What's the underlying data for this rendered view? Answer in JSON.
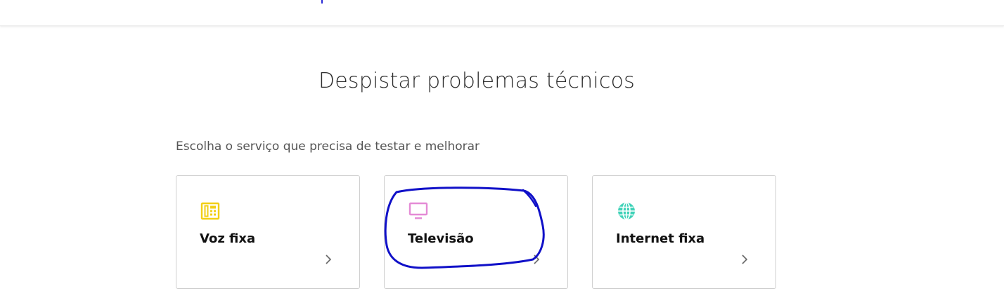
{
  "header": {
    "accent_color": "#2a2ad6"
  },
  "page": {
    "title": "Despistar problemas técnicos",
    "subtitle": "Escolha o serviço que precisa de testar e melhorar"
  },
  "services": [
    {
      "label": "Voz fixa",
      "icon": "phone-icon",
      "icon_color": "#f2cf16"
    },
    {
      "label": "Televisão",
      "icon": "tv-icon",
      "icon_color": "#e48bd6"
    },
    {
      "label": "Internet fixa",
      "icon": "globe-icon",
      "icon_color": "#40d2b8"
    }
  ],
  "annotation": {
    "color": "#1010c8"
  }
}
